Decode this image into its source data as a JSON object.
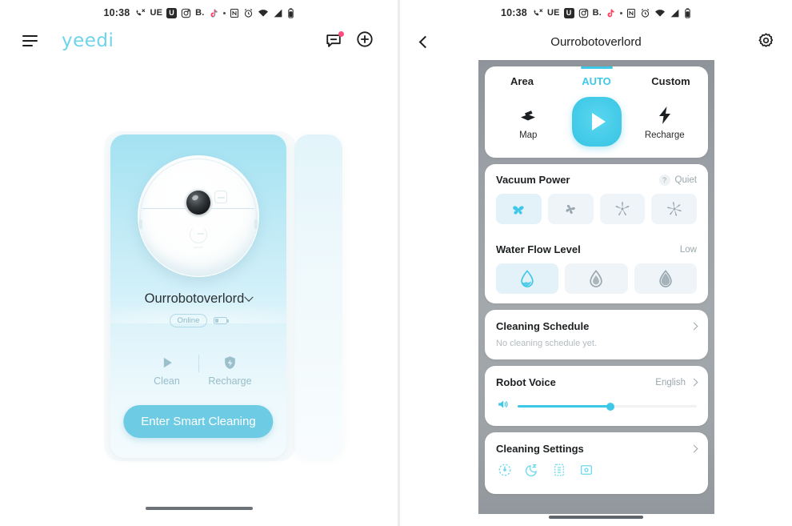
{
  "status_bar": {
    "time": "10:38",
    "icons": [
      "bluetooth-call-icon",
      "UE",
      "U",
      "instagram-icon",
      "B.",
      "tiktok-icon",
      "dot",
      "nfc-icon",
      "alarm-icon",
      "wifi-icon",
      "signal-icon",
      "battery-icon"
    ]
  },
  "left_screen": {
    "header": {
      "menu_icon": "hamburger-icon",
      "brand": "yeedi",
      "message_icon": "message-icon",
      "add_icon": "add-circle-icon",
      "has_notification": true
    },
    "device_card": {
      "device_name": "Ourrobotoverlord",
      "dropdown_icon": "chevron-down-icon",
      "status": "Online",
      "battery_icon": "battery-icon",
      "actions": [
        {
          "label": "Clean",
          "icon": "play-icon"
        },
        {
          "label": "Recharge",
          "icon": "recharge-shield-icon"
        }
      ],
      "cta_label": "Enter Smart Cleaning"
    }
  },
  "right_screen": {
    "header": {
      "back_icon": "back-chevron-icon",
      "title": "Ourrobotoverlord",
      "settings_icon": "gear-icon"
    },
    "mode_panel": {
      "tabs": [
        {
          "label": "Area",
          "active": false
        },
        {
          "label": "AUTO",
          "active": true
        },
        {
          "label": "Custom",
          "active": false
        }
      ],
      "left_action": {
        "label": "Map",
        "icon": "map-layers-icon"
      },
      "play_button": {
        "icon": "play-icon"
      },
      "right_action": {
        "label": "Recharge",
        "icon": "lightning-bolt-icon"
      }
    },
    "vacuum_power": {
      "title": "Vacuum Power",
      "help_icon": "question-mark-icon",
      "value": "Quiet",
      "options": [
        {
          "icon": "fan-2-blade-icon",
          "selected": true
        },
        {
          "icon": "fan-3-blade-icon",
          "selected": false
        },
        {
          "icon": "fan-5-blade-icon",
          "selected": false
        },
        {
          "icon": "fan-6-blade-icon",
          "selected": false
        }
      ]
    },
    "water_flow": {
      "title": "Water Flow Level",
      "value": "Low",
      "options": [
        {
          "icon": "droplet-low-icon",
          "selected": true
        },
        {
          "icon": "droplet-medium-icon",
          "selected": false
        },
        {
          "icon": "droplet-high-icon",
          "selected": false
        }
      ]
    },
    "cleaning_schedule": {
      "title": "Cleaning Schedule",
      "chevron_icon": "chevron-right-icon",
      "subtitle": "No cleaning schedule yet."
    },
    "robot_voice": {
      "title": "Robot Voice",
      "value": "English",
      "chevron_icon": "chevron-right-icon",
      "volume_icon": "speaker-icon",
      "volume_percent": 52
    },
    "cleaning_settings": {
      "title": "Cleaning Settings",
      "chevron_icon": "chevron-right-icon",
      "icons": [
        "target-clean-icon",
        "do-not-disturb-moon-icon",
        "carpet-icon",
        "dock-area-icon"
      ]
    }
  },
  "colors": {
    "accent_cyan": "#3ec8e8",
    "brand_blue": "#6fd4ea",
    "card_top": "#a3e2f1",
    "card_bottom": "#f3fbfd",
    "notification_pink": "#ff4d7e",
    "panel_bg": "#9aa0a5"
  }
}
